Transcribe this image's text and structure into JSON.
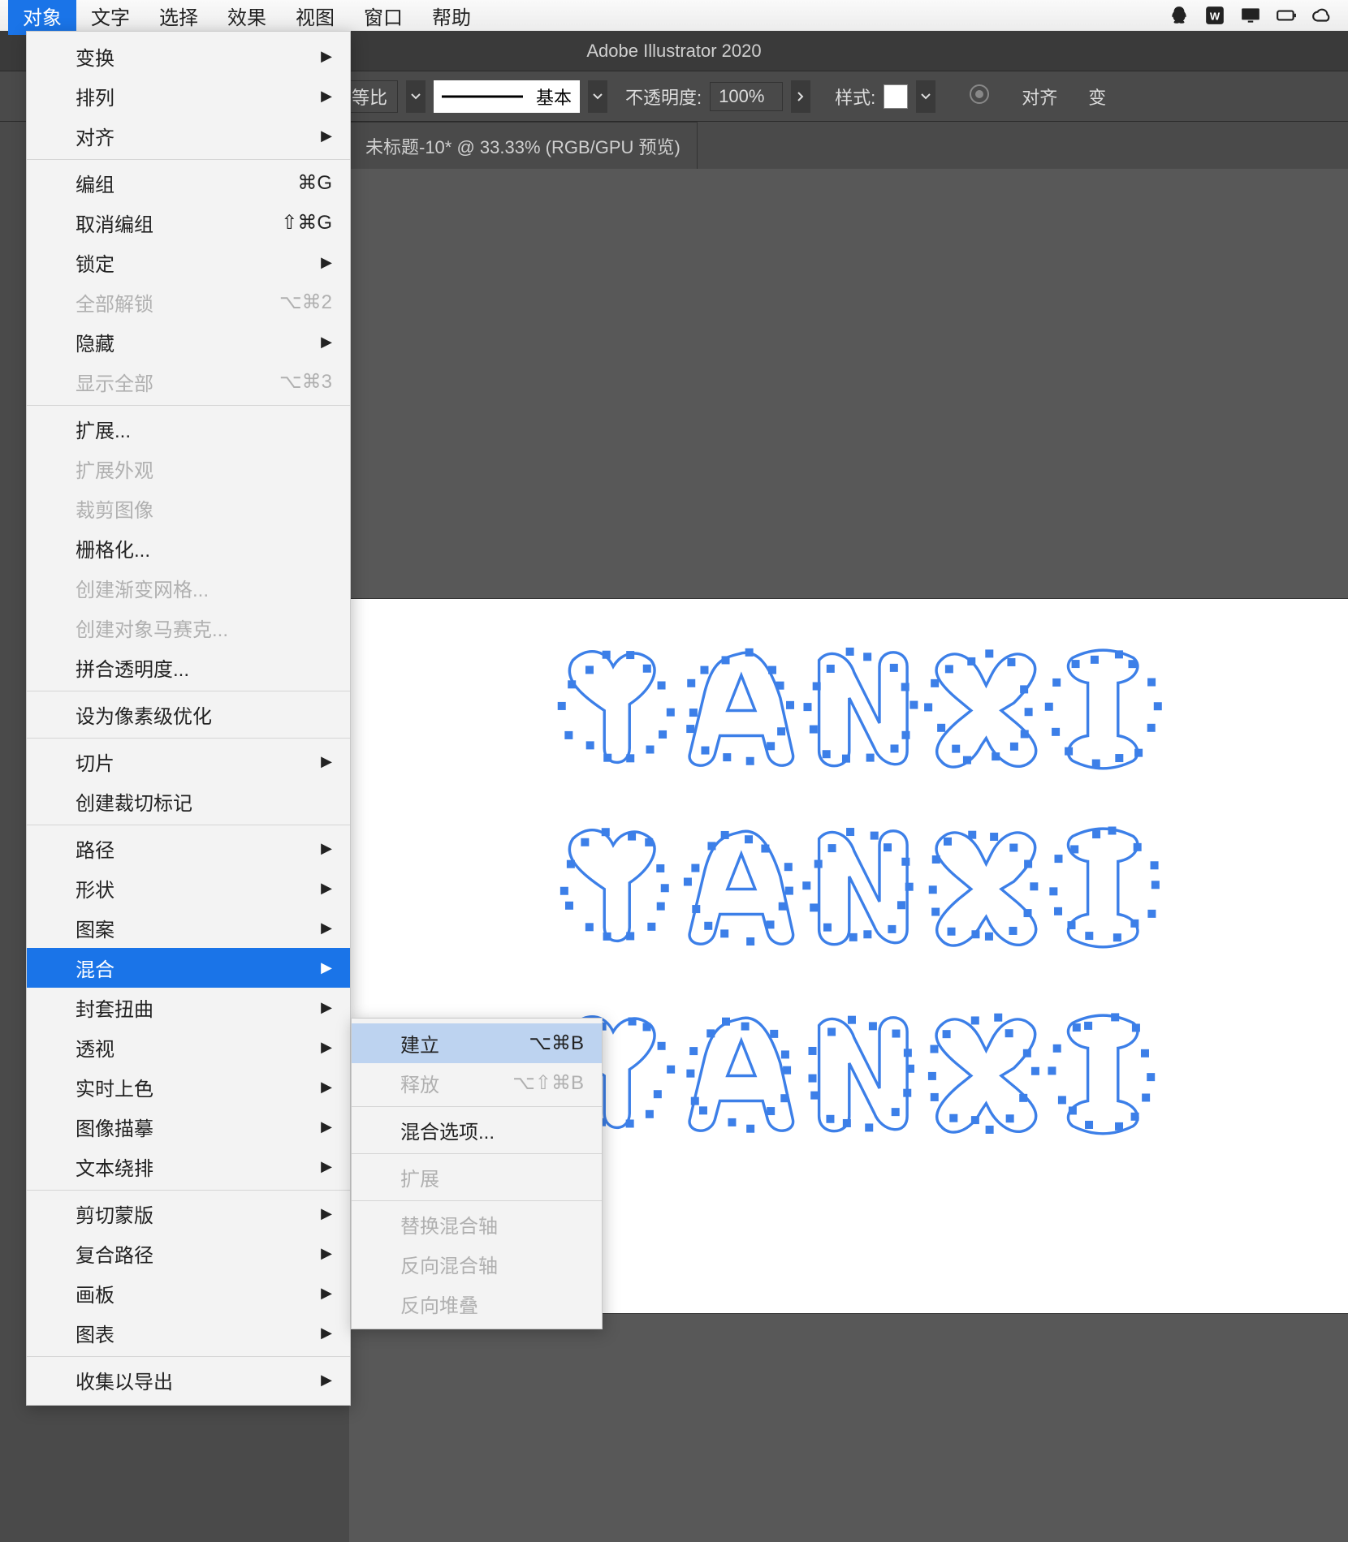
{
  "menubar": {
    "items": [
      "对象",
      "文字",
      "选择",
      "效果",
      "视图",
      "窗口",
      "帮助"
    ],
    "active_index": 0
  },
  "app_title": "Adobe Illustrator 2020",
  "control_bar": {
    "ratio_label": "等比",
    "stroke_label": "基本",
    "opacity_label": "不透明度:",
    "opacity_value": "100%",
    "style_label": "样式:",
    "align_label": "对齐",
    "transform_stub": "变"
  },
  "tab": "未标题-10* @ 33.33% (RGB/GPU 预览)",
  "object_menu": {
    "groups": [
      [
        {
          "label": "变换",
          "submenu": true
        },
        {
          "label": "排列",
          "submenu": true
        },
        {
          "label": "对齐",
          "submenu": true
        }
      ],
      [
        {
          "label": "编组",
          "shortcut": "⌘G"
        },
        {
          "label": "取消编组",
          "shortcut": "⇧⌘G"
        },
        {
          "label": "锁定",
          "submenu": true
        },
        {
          "label": "全部解锁",
          "shortcut": "⌥⌘2",
          "disabled": true
        },
        {
          "label": "隐藏",
          "submenu": true
        },
        {
          "label": "显示全部",
          "shortcut": "⌥⌘3",
          "disabled": true
        }
      ],
      [
        {
          "label": "扩展..."
        },
        {
          "label": "扩展外观",
          "disabled": true
        },
        {
          "label": "裁剪图像",
          "disabled": true
        },
        {
          "label": "栅格化..."
        },
        {
          "label": "创建渐变网格...",
          "disabled": true
        },
        {
          "label": "创建对象马赛克...",
          "disabled": true
        },
        {
          "label": "拼合透明度..."
        }
      ],
      [
        {
          "label": "设为像素级优化"
        }
      ],
      [
        {
          "label": "切片",
          "submenu": true
        },
        {
          "label": "创建裁切标记"
        }
      ],
      [
        {
          "label": "路径",
          "submenu": true
        },
        {
          "label": "形状",
          "submenu": true
        },
        {
          "label": "图案",
          "submenu": true
        },
        {
          "label": "混合",
          "submenu": true,
          "highlighted": true
        },
        {
          "label": "封套扭曲",
          "submenu": true
        },
        {
          "label": "透视",
          "submenu": true
        },
        {
          "label": "实时上色",
          "submenu": true
        },
        {
          "label": "图像描摹",
          "submenu": true
        },
        {
          "label": "文本绕排",
          "submenu": true
        }
      ],
      [
        {
          "label": "剪切蒙版",
          "submenu": true
        },
        {
          "label": "复合路径",
          "submenu": true
        },
        {
          "label": "画板",
          "submenu": true
        },
        {
          "label": "图表",
          "submenu": true
        }
      ],
      [
        {
          "label": "收集以导出",
          "submenu": true
        }
      ]
    ]
  },
  "blend_submenu": [
    {
      "label": "建立",
      "shortcut": "⌥⌘B",
      "highlighted": true
    },
    {
      "label": "释放",
      "shortcut": "⌥⇧⌘B",
      "disabled": true
    },
    {
      "sep": true
    },
    {
      "label": "混合选项..."
    },
    {
      "sep": true
    },
    {
      "label": "扩展",
      "disabled": true
    },
    {
      "sep": true
    },
    {
      "label": "替换混合轴",
      "disabled": true
    },
    {
      "label": "反向混合轴",
      "disabled": true
    },
    {
      "label": "反向堆叠",
      "disabled": true
    }
  ],
  "artboard_text": "YANXI",
  "selection_color": "#3C7FE8"
}
